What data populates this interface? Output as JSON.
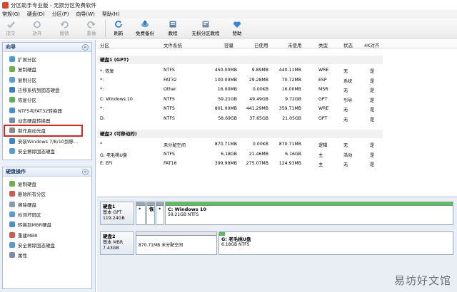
{
  "window": {
    "title": "分区助手专业版 - 无损分区免费软件"
  },
  "menu": [
    "常规(G)",
    "硬盘(D)",
    "分区(P)",
    "向导(W)",
    "帮助(H)"
  ],
  "toolbar": {
    "items": [
      {
        "label": "提交",
        "icon": "check-icon",
        "disabled": true
      },
      {
        "label": "放弃",
        "icon": "discard-icon",
        "disabled": true
      },
      {
        "label": "撤销",
        "icon": "undo-icon",
        "disabled": true
      },
      {
        "label": "重做",
        "icon": "redo-icon",
        "disabled": true
      },
      {
        "label": "刷新",
        "icon": "refresh-icon",
        "disabled": false
      },
      {
        "label": "免费备份",
        "icon": "backup-icon",
        "disabled": false
      },
      {
        "label": "教程",
        "icon": "tutorial-icon",
        "disabled": false
      },
      {
        "label": "无损分区教程",
        "icon": "partition-tutorial-icon",
        "disabled": false
      },
      {
        "label": "赞助",
        "icon": "heart-icon",
        "disabled": false
      }
    ]
  },
  "wizard_panel": {
    "title": "向导",
    "items": [
      "扩展分区",
      "复制硬盘",
      "复制分区",
      "迁移系统到固态硬盘",
      "恢复分区",
      "NTFS与FAT32转换器",
      "动态硬盘转换器",
      "制作启动光盘",
      "安装Windows 7/8/10到移...",
      "安全擦除固态硬盘"
    ]
  },
  "disk_ops_panel": {
    "title": "硬盘操作",
    "items": [
      "复制硬盘",
      "删除所有分区",
      "擦除硬盘",
      "检测坏扇区",
      "转换到MBR硬盘",
      "重建MBR",
      "安全擦除固态硬盘",
      "属性"
    ]
  },
  "table": {
    "headers": [
      "分区",
      "文件系统",
      "容量",
      "已使用",
      "未使用",
      "类型",
      "状态",
      "4K对齐"
    ],
    "disks": [
      {
        "name": "硬盘1 (GPT)",
        "rows": [
          [
            "*: 恢复",
            "NTFS",
            "450.00MB",
            "9.89MB",
            "440.11MB",
            "WRE",
            "无",
            "是"
          ],
          [
            "*:",
            "FAT32",
            "100.00MB",
            "29.28MB",
            "70.72MB",
            "ESP",
            "系统",
            "是"
          ],
          [
            "*:",
            "Other",
            "16.00MB",
            "0.00KB",
            "16.00MB",
            "MSR",
            "无",
            "是"
          ],
          [
            "C: Windows 10",
            "NTFS",
            "59.21GB",
            "49.49GB",
            "9.72GB",
            "GPT",
            "引导",
            "是"
          ],
          [
            "*:",
            "NTFS",
            "801.00MB",
            "441.29MB",
            "359.71MB",
            "WRE",
            "无",
            "是"
          ],
          [
            "D:",
            "NTFS",
            "58.69GB",
            "37.65GB",
            "21.05GB",
            "GPT",
            "无",
            "是"
          ]
        ]
      },
      {
        "name": "硬盘2 (可移动的)",
        "rows": [
          [
            "*",
            "未分配空间",
            "870.71MB",
            "0.00KB",
            "870.71MB",
            "逻辑",
            "无",
            "是"
          ],
          [
            "G: 老毛桃U盘",
            "NTFS",
            "6.18GB",
            "21.46MB",
            "6.16GB",
            "主",
            "活动",
            "是"
          ],
          [
            "E: EFI",
            "FAT16",
            "399.99MB",
            "275.07MB",
            "124.93MB",
            "主",
            "无",
            "是"
          ]
        ]
      }
    ]
  },
  "disk_map": {
    "disk1": {
      "name": "硬盘1",
      "type": "基本 GPT",
      "size": "119.24GB",
      "partitions": [
        {
          "label": "*",
          "sub": ""
        },
        {
          "label": "恢",
          "sub": ""
        },
        {
          "label": "*",
          "sub": ""
        },
        {
          "label": "C: Windows 10",
          "sub": "59.21GB NTFS"
        }
      ]
    },
    "disk2": {
      "name": "硬盘2",
      "type": "基本 MBR",
      "size": "7.43GB",
      "partitions": [
        {
          "label": "",
          "sub": "870.71MB 未分配空间"
        },
        {
          "label": "G: 老毛桃U盘",
          "sub": "6.18GB NTFS"
        }
      ]
    }
  },
  "watermark": "易坊好文馆",
  "colors": {
    "highlight": "#d0272b",
    "used_bar": "#57c24c",
    "panel_head": "#1d3a66"
  }
}
